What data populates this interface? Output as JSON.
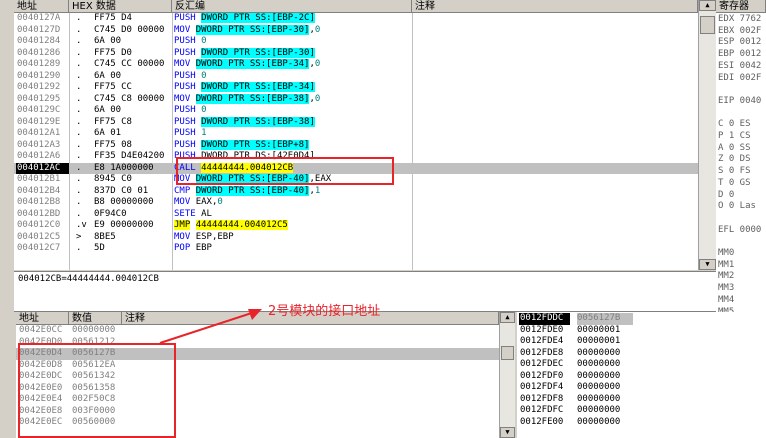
{
  "disasm": {
    "headers": {
      "address": "地址",
      "hex": "HEX 数据",
      "disasm": "反汇编",
      "comment": "注释"
    },
    "rows": [
      {
        "addr": "0040127A",
        "mark": ".",
        "hex": "FF75 D4",
        "mn": "PUSH",
        "ops": [
          {
            "t": "DWORD PTR SS:[EBP-2C]",
            "c": "hl"
          }
        ]
      },
      {
        "addr": "0040127D",
        "mark": ".",
        "hex": "C745 D0 00000",
        "mn": "MOV",
        "ops": [
          {
            "t": "DWORD PTR SS:[EBP-30]",
            "c": "hl"
          },
          {
            "t": ",",
            "c": ""
          },
          {
            "t": "0",
            "c": "num"
          }
        ]
      },
      {
        "addr": "00401284",
        "mark": ".",
        "hex": "6A 00",
        "mn": "PUSH",
        "ops": [
          {
            "t": "0",
            "c": "num"
          }
        ]
      },
      {
        "addr": "00401286",
        "mark": ".",
        "hex": "FF75 D0",
        "mn": "PUSH",
        "ops": [
          {
            "t": "DWORD PTR SS:[EBP-30]",
            "c": "hl"
          }
        ]
      },
      {
        "addr": "00401289",
        "mark": ".",
        "hex": "C745 CC 00000",
        "mn": "MOV",
        "ops": [
          {
            "t": "DWORD PTR SS:[EBP-34]",
            "c": "hl"
          },
          {
            "t": ",",
            "c": ""
          },
          {
            "t": "0",
            "c": "num"
          }
        ]
      },
      {
        "addr": "00401290",
        "mark": ".",
        "hex": "6A 00",
        "mn": "PUSH",
        "ops": [
          {
            "t": "0",
            "c": "num"
          }
        ]
      },
      {
        "addr": "00401292",
        "mark": ".",
        "hex": "FF75 CC",
        "mn": "PUSH",
        "ops": [
          {
            "t": "DWORD PTR SS:[EBP-34]",
            "c": "hl"
          }
        ]
      },
      {
        "addr": "00401295",
        "mark": ".",
        "hex": "C745 C8 00000",
        "mn": "MOV",
        "ops": [
          {
            "t": "DWORD PTR SS:[EBP-38]",
            "c": "hl"
          },
          {
            "t": ",",
            "c": ""
          },
          {
            "t": "0",
            "c": "num"
          }
        ]
      },
      {
        "addr": "0040129C",
        "mark": ".",
        "hex": "6A 00",
        "mn": "PUSH",
        "ops": [
          {
            "t": "0",
            "c": "num"
          }
        ]
      },
      {
        "addr": "0040129E",
        "mark": ".",
        "hex": "FF75 C8",
        "mn": "PUSH",
        "ops": [
          {
            "t": "DWORD PTR SS:[EBP-38]",
            "c": "hl"
          }
        ]
      },
      {
        "addr": "004012A1",
        "mark": ".",
        "hex": "6A 01",
        "mn": "PUSH",
        "ops": [
          {
            "t": "1",
            "c": "num"
          }
        ]
      },
      {
        "addr": "004012A3",
        "mark": ".",
        "hex": "FF75 08",
        "mn": "PUSH",
        "ops": [
          {
            "t": "DWORD PTR SS:[EBP+8]",
            "c": "hl"
          }
        ]
      },
      {
        "addr": "004012A6",
        "mark": ".",
        "hex": "FF35 D4E04200",
        "mn": "PUSH",
        "ops": [
          {
            "t": "DWORD PTR DS:[42E0D4]",
            "c": ""
          }
        ]
      },
      {
        "addr": "004012AC",
        "mark": ".",
        "hex": "E8 1A000000",
        "mn": "CALL",
        "ops": [
          {
            "t": "44444444.004012CB",
            "c": "jmp"
          }
        ],
        "selected": true
      },
      {
        "addr": "004012B1",
        "mark": ".",
        "hex": "8945 C0",
        "mn": "MOV",
        "ops": [
          {
            "t": "DWORD PTR SS:[EBP-40]",
            "c": "hl"
          },
          {
            "t": ",EAX",
            "c": ""
          }
        ]
      },
      {
        "addr": "004012B4",
        "mark": ".",
        "hex": "837D C0 01",
        "mn": "CMP",
        "ops": [
          {
            "t": "DWORD PTR SS:[EBP-40]",
            "c": "hl"
          },
          {
            "t": ",",
            "c": ""
          },
          {
            "t": "1",
            "c": "num"
          }
        ]
      },
      {
        "addr": "004012B8",
        "mark": ".",
        "hex": "B8 00000000",
        "mn": "MOV",
        "ops": [
          {
            "t": "EAX,",
            "c": ""
          },
          {
            "t": "0",
            "c": "num"
          }
        ]
      },
      {
        "addr": "004012BD",
        "mark": ".",
        "hex": "0F94C0",
        "mn": "SETE",
        "ops": [
          {
            "t": "AL",
            "c": ""
          }
        ]
      },
      {
        "addr": "004012C0",
        "mark": ".v",
        "hex": "E9 00000000",
        "mn": "JMP",
        "ops": [
          {
            "t": "44444444.004012C5",
            "c": "jmp"
          }
        ]
      },
      {
        "addr": "004012C5",
        "mark": ">",
        "hex": "8BE5",
        "mn": "MOV",
        "ops": [
          {
            "t": "ESP,EBP",
            "c": ""
          }
        ]
      },
      {
        "addr": "004012C7",
        "mark": ".",
        "hex": "5D",
        "mn": "POP",
        "ops": [
          {
            "t": "EBP",
            "c": ""
          }
        ]
      }
    ]
  },
  "info_line": "004012CB=44444444.004012CB",
  "registers": {
    "header": "寄存器",
    "lines": [
      "EDX 7762",
      "EBX 002F",
      "ESP 0012",
      "EBP 0012",
      "ESI 0042",
      "EDI 002F",
      "",
      "EIP 0040",
      "",
      "C 0  ES",
      "P 1  CS",
      "A 0  SS",
      "Z 0  DS",
      "S 0  FS",
      "T 0  GS",
      "D 0",
      "O 0  Las",
      "",
      "EFL 0000",
      "",
      "MM0",
      "MM1",
      "MM2",
      "MM3",
      "MM4",
      "MM5"
    ]
  },
  "dump": {
    "headers": {
      "address": "地址",
      "value": "数值",
      "comment": "注释"
    },
    "rows": [
      {
        "addr": "0042E0CC",
        "val": "00000000"
      },
      {
        "addr": "0042E0D0",
        "val": "00561212"
      },
      {
        "addr": "0042E0D4",
        "val": "0056127B",
        "selected": true
      },
      {
        "addr": "0042E0D8",
        "val": "005612EA"
      },
      {
        "addr": "0042E0DC",
        "val": "00561342"
      },
      {
        "addr": "0042E0E0",
        "val": "00561358"
      },
      {
        "addr": "0042E0E4",
        "val": "002F50C8"
      },
      {
        "addr": "0042E0E8",
        "val": "003F0000"
      },
      {
        "addr": "0042E0EC",
        "val": "00560000"
      }
    ]
  },
  "stack": {
    "rows": [
      {
        "addr": "0012FDDC",
        "val": "0056127B",
        "top": true
      },
      {
        "addr": "0012FDE0",
        "val": "00000001"
      },
      {
        "addr": "0012FDE4",
        "val": "00000001"
      },
      {
        "addr": "0012FDE8",
        "val": "00000000"
      },
      {
        "addr": "0012FDEC",
        "val": "00000000"
      },
      {
        "addr": "0012FDF0",
        "val": "00000000"
      },
      {
        "addr": "0012FDF4",
        "val": "00000000"
      },
      {
        "addr": "0012FDF8",
        "val": "00000000"
      },
      {
        "addr": "0012FDFC",
        "val": "00000000"
      },
      {
        "addr": "0012FE00",
        "val": "00000000"
      }
    ]
  },
  "annotation": "2号模块的接口地址",
  "colors": {
    "annotation": "#e8232a",
    "operand_highlight": "#00ffff",
    "jump_highlight": "#ffff00"
  }
}
